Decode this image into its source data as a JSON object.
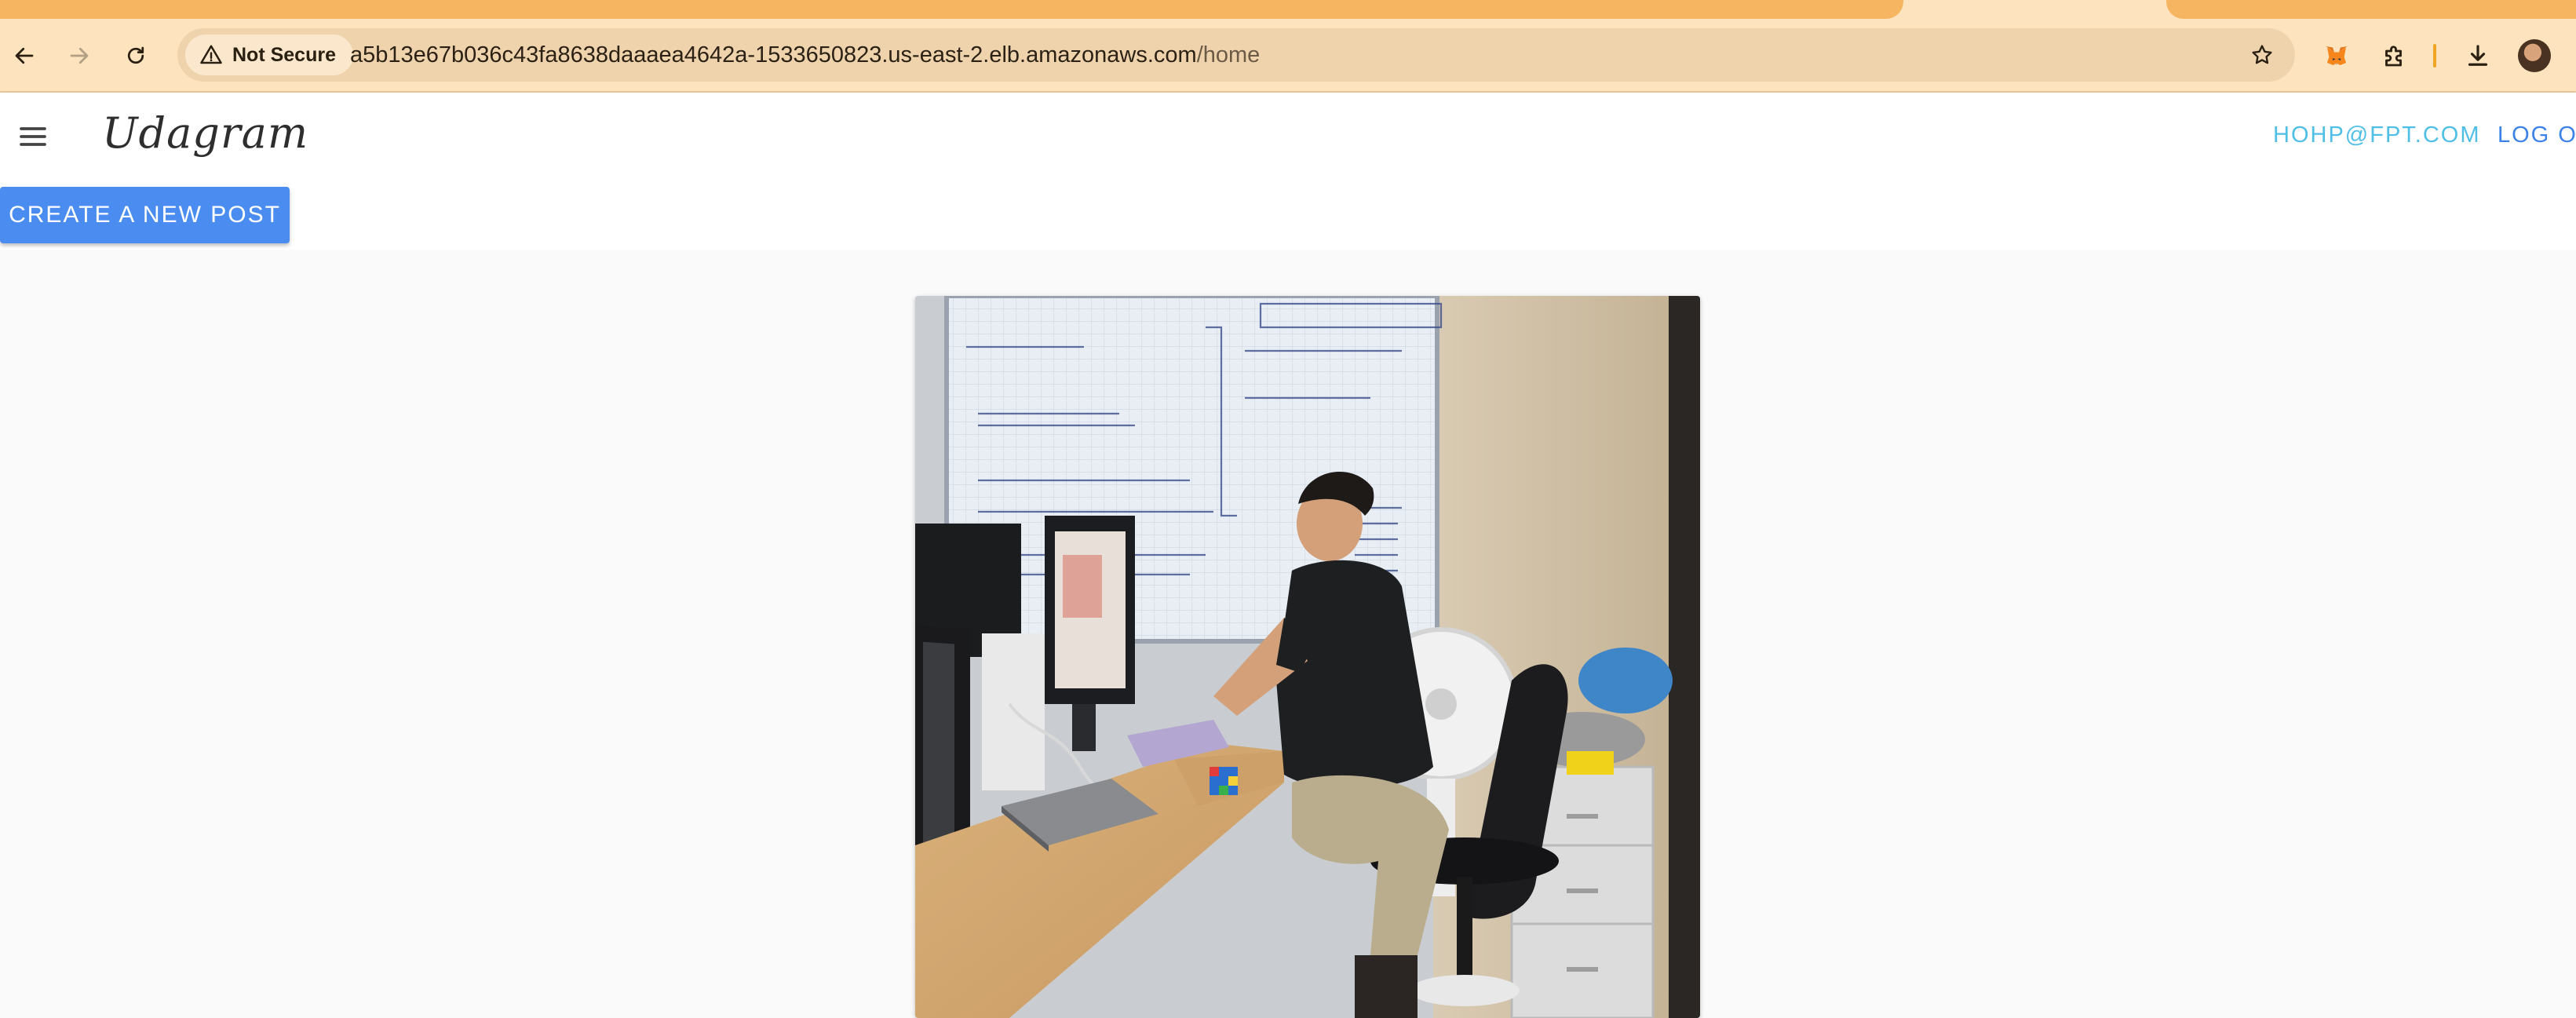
{
  "browser": {
    "security_label": "Not Secure",
    "url_host": "a5b13e67b036c43fa8638daaaea4642a-1533650823.us-east-2.elb.amazonaws.com",
    "url_path": "/home",
    "theme_color": "#fde3be",
    "tab_color": "#f6b560",
    "icons": [
      "back-icon",
      "forward-icon",
      "reload-icon",
      "warning-icon",
      "star-icon",
      "fox-extension-icon",
      "puzzle-extension-icon",
      "download-icon",
      "profile-avatar"
    ]
  },
  "header": {
    "brand": "Udagram",
    "user_email": "HOHP@FPT.COM",
    "logout_label": "LOG OUT",
    "email_color": "#4fbfe6",
    "logout_color": "#3d82e6"
  },
  "toolbar": {
    "create_post_label": "CREATE A NEW POST",
    "button_color": "#4b8cf0"
  },
  "feed": {
    "posts": [
      {
        "image_alt": "Man working at a desk with computer monitors in front of a whiteboard"
      }
    ]
  }
}
